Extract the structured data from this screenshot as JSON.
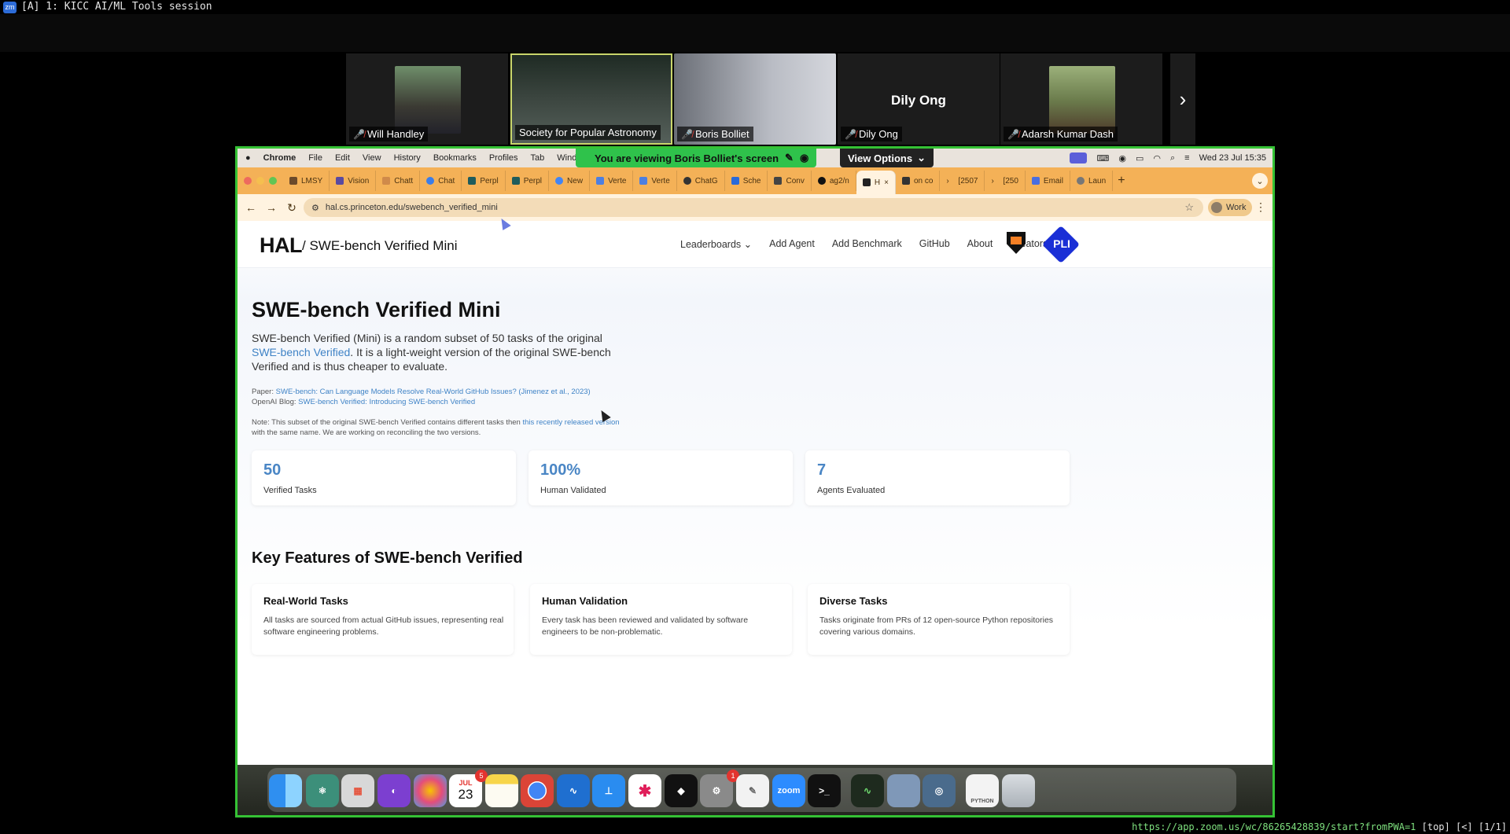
{
  "terminal": {
    "title": "[A] 1: KICC AI/ML Tools session",
    "app_icon": "zm"
  },
  "participants": {
    "tiles": [
      {
        "name": "Will Handley",
        "muted": true
      },
      {
        "name": "Society for Popular Astronomy",
        "muted": false
      },
      {
        "name": "Boris Bolliet",
        "muted": true
      },
      {
        "name": "Dily Ong",
        "muted": true,
        "display_name": "Dily Ong"
      },
      {
        "name": "Adarsh Kumar Dash",
        "muted": true
      }
    ],
    "next_icon": "chevron-right-icon"
  },
  "zoom": {
    "viewing_banner": "You are viewing  Boris Bolliet's screen",
    "view_options": "View Options"
  },
  "menubar": {
    "items": [
      "Chrome",
      "File",
      "Edit",
      "View",
      "History",
      "Bookmarks",
      "Profiles",
      "Tab",
      "Window"
    ],
    "datetime": "Wed 23 Jul  15:35"
  },
  "tabs": [
    {
      "label": "LMSY"
    },
    {
      "label": "Vision"
    },
    {
      "label": "Chatt"
    },
    {
      "label": "Chat"
    },
    {
      "label": "Perpl"
    },
    {
      "label": "Perpl"
    },
    {
      "label": "New"
    },
    {
      "label": "Verte"
    },
    {
      "label": "Verte"
    },
    {
      "label": "ChatG"
    },
    {
      "label": "Sche"
    },
    {
      "label": "Conv"
    },
    {
      "label": "ag2/n"
    },
    {
      "label": "H"
    },
    {
      "label": "on co"
    },
    {
      "label": "[2507"
    },
    {
      "label": "[250"
    },
    {
      "label": "Email"
    },
    {
      "label": "Laun"
    }
  ],
  "address": {
    "url": "hal.cs.princeton.edu/swebench_verified_mini",
    "profile": "Work"
  },
  "site": {
    "logo": "HAL",
    "crumb": "/ SWE-bench Verified Mini",
    "nav": [
      "Leaderboards",
      "Add Agent",
      "Add Benchmark",
      "GitHub",
      "About",
      "Creators"
    ],
    "pli": "PLI"
  },
  "hero": {
    "title": "SWE-bench Verified Mini",
    "desc_pre": "SWE-bench Verified (Mini) is a random subset of 50 tasks of the original ",
    "desc_link": "SWE-bench Verified",
    "desc_post": ". It is a light-weight version of the original SWE-bench Verified and is thus cheaper to evaluate.",
    "paper_label": "Paper: ",
    "paper_link": "SWE-bench: Can Language Models Resolve Real-World GitHub Issues? (Jimenez et al., 2023)",
    "blog_label": "OpenAI Blog: ",
    "blog_link": "SWE-bench Verified: Introducing SWE-bench Verified",
    "note_pre": "Note: This subset of the original SWE-bench Verified contains different tasks then ",
    "note_link": "this recently released version",
    "note_post": " with the same name. We are working on reconciling the two versions."
  },
  "stats": [
    {
      "value": "50",
      "label": "Verified Tasks"
    },
    {
      "value": "100%",
      "label": "Human Validated"
    },
    {
      "value": "7",
      "label": "Agents Evaluated"
    }
  ],
  "features": {
    "title": "Key Features of SWE-bench Verified",
    "cards": [
      {
        "title": "Real-World Tasks",
        "desc": "All tasks are sourced from actual GitHub issues, representing real software engineering problems."
      },
      {
        "title": "Human Validation",
        "desc": "Every task has been reviewed and validated by software engineers to be non-problematic."
      },
      {
        "title": "Diverse Tasks",
        "desc": "Tasks originate from PRs of 12 open-source Python repositories covering various domains."
      }
    ]
  },
  "dock": {
    "calendar_month": "JUL",
    "calendar_day": "23",
    "calendar_badge": "5",
    "settings_badge": "1",
    "zoom_label": "zoom",
    "python_label": "PYTHON"
  },
  "status": {
    "url": "https://app.zoom.us/wc/86265428839/start?fromPWA=1",
    "tail": " [top] [<] [1/1]"
  }
}
